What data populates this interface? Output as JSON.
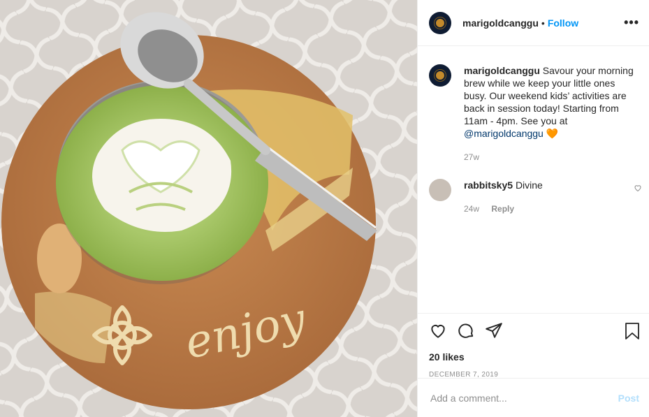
{
  "header": {
    "username": "marigoldcanggu",
    "separator": "•",
    "follow_label": "Follow",
    "more_icon": "more-options-icon"
  },
  "photo": {
    "board_text": "enjoy"
  },
  "comments": [
    {
      "username": "marigoldcanggu",
      "text": "Savour your morning brew while we keep your little ones busy. Our weekend kids’ activities are back in session today! Starting from 11am - 4pm. See you at",
      "mention": "@marigoldcanggu",
      "emoji": "🧡",
      "age": "27w"
    },
    {
      "username": "rabbitsky5",
      "text": "Divine",
      "age": "24w",
      "reply_label": "Reply"
    }
  ],
  "actions": {
    "like_icon": "heart-icon",
    "comment_icon": "comment-icon",
    "share_icon": "share-icon",
    "save_icon": "bookmark-icon"
  },
  "likes_text": "20 likes",
  "date_text": "DECEMBER 7, 2019",
  "add_comment": {
    "placeholder": "Add a comment...",
    "post_label": "Post"
  },
  "colors": {
    "accent": "#0095f6",
    "post_disabled": "#b2dffc",
    "muted": "#8e8e8e"
  }
}
